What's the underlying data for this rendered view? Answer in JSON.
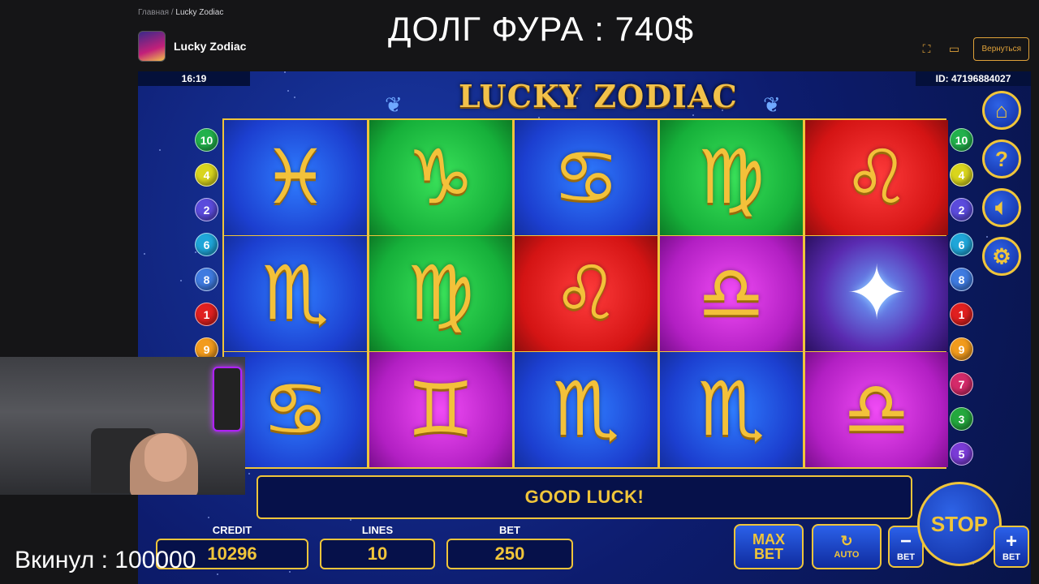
{
  "site": {
    "breadcrumb": {
      "home": "Главная",
      "separator": "/",
      "current": "Lucky Zodiac"
    },
    "game_name": "Lucky Zodiac",
    "back_button": "Вернуться",
    "icons": {
      "fullscreen": "fullscreen-icon",
      "theater": "theater-mode-icon"
    }
  },
  "overlay": {
    "headline": "ДОЛГ ФУРА : 740$",
    "deposit_text": "Вкинул : 100000"
  },
  "game": {
    "clock": "16:19",
    "session_id": "ID: 47196884027",
    "logo": "LUCKY ZODIAC",
    "message": "GOOD LUCK!",
    "credit_label": "CREDIT",
    "credit_value": "10296",
    "lines_label": "LINES",
    "lines_value": "10",
    "bet_label": "BET",
    "bet_value": "250",
    "max_bet": {
      "line1": "MAX",
      "line2": "BET"
    },
    "auto_label": "AUTO",
    "stop_label": "STOP",
    "bet_minus": {
      "sign": "−",
      "label": "BET"
    },
    "bet_plus": {
      "sign": "+",
      "label": "BET"
    },
    "left_lines": [
      "10",
      "4",
      "2",
      "6",
      "8",
      "1",
      "9"
    ],
    "right_lines": [
      "10",
      "4",
      "2",
      "6",
      "8",
      "1",
      "9",
      "7",
      "3",
      "5"
    ],
    "line_colors": {
      "10": "#22b14c",
      "4": "#d9d51d",
      "2": "#5b4bdc",
      "6": "#1fa6d9",
      "8": "#3f7be0",
      "1": "#e02020",
      "9": "#f29b1d",
      "7": "#d42a6a",
      "3": "#24a83e",
      "5": "#7a3bd6"
    },
    "side_buttons": [
      "home-icon",
      "help-icon",
      "sound-icon",
      "settings-icon"
    ],
    "reels": [
      [
        {
          "symbol": "Pisces",
          "glyph": "♓",
          "bg": "blue"
        },
        {
          "symbol": "Scorpio",
          "glyph": "♏",
          "bg": "blue"
        },
        {
          "symbol": "Cancer",
          "glyph": "♋",
          "bg": "blue"
        }
      ],
      [
        {
          "symbol": "Capricorn",
          "glyph": "♑",
          "bg": "green"
        },
        {
          "symbol": "Virgo",
          "glyph": "♍",
          "bg": "green"
        },
        {
          "symbol": "Gemini",
          "glyph": "♊",
          "bg": "purple"
        }
      ],
      [
        {
          "symbol": "Cancer",
          "glyph": "♋",
          "bg": "blue"
        },
        {
          "symbol": "Leo",
          "glyph": "♌",
          "bg": "red"
        },
        {
          "symbol": "Scorpio",
          "glyph": "♏",
          "bg": "blue"
        }
      ],
      [
        {
          "symbol": "Virgo",
          "glyph": "♍",
          "bg": "green"
        },
        {
          "symbol": "Libra",
          "glyph": "♎",
          "bg": "purple"
        },
        {
          "symbol": "Scorpio",
          "glyph": "♏",
          "bg": "blue"
        }
      ],
      [
        {
          "symbol": "Leo",
          "glyph": "♌",
          "bg": "red"
        },
        {
          "symbol": "Wizard",
          "glyph": "✦",
          "bg": "wizard"
        },
        {
          "symbol": "Libra",
          "glyph": "♎",
          "bg": "purple"
        }
      ]
    ]
  }
}
